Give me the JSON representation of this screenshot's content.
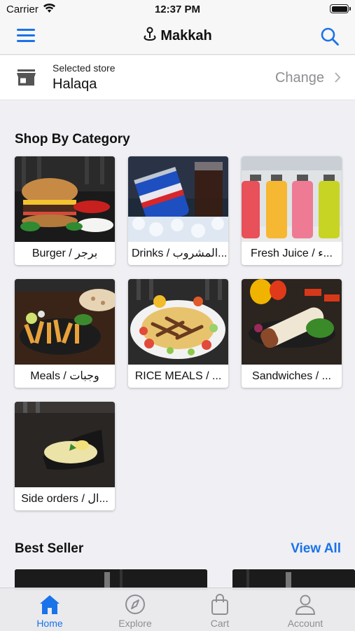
{
  "status_bar": {
    "carrier": "Carrier",
    "time": "12:37 PM"
  },
  "nav": {
    "title": "Makkah",
    "menu_icon": "hamburger-menu-icon",
    "search_icon": "search-icon",
    "location_icon": "location-pin-icon"
  },
  "store": {
    "caption": "Selected store",
    "name": "Halaqa",
    "change_label": "Change"
  },
  "categories_section": {
    "title": "Shop By Category"
  },
  "categories": [
    {
      "label": "Burger / برجر"
    },
    {
      "label": "Drinks /   المشروب..."
    },
    {
      "label": "Fresh Juice / ء..."
    },
    {
      "label": "Meals / وجبات"
    },
    {
      "label": "RICE MEALS / ..."
    },
    {
      "label": "Sandwiches / ..."
    },
    {
      "label": "Side orders / ال..."
    }
  ],
  "best_seller": {
    "title": "Best Seller",
    "view_all": "View All"
  },
  "tabs": [
    {
      "label": "Home",
      "icon": "home-icon",
      "active": true
    },
    {
      "label": "Explore",
      "icon": "compass-icon",
      "active": false
    },
    {
      "label": "Cart",
      "icon": "shopping-bag-icon",
      "active": false
    },
    {
      "label": "Account",
      "icon": "user-icon",
      "active": false
    }
  ],
  "colors": {
    "accent": "#1a73e8",
    "background": "#efeff4",
    "inactive": "#8e8e93"
  }
}
